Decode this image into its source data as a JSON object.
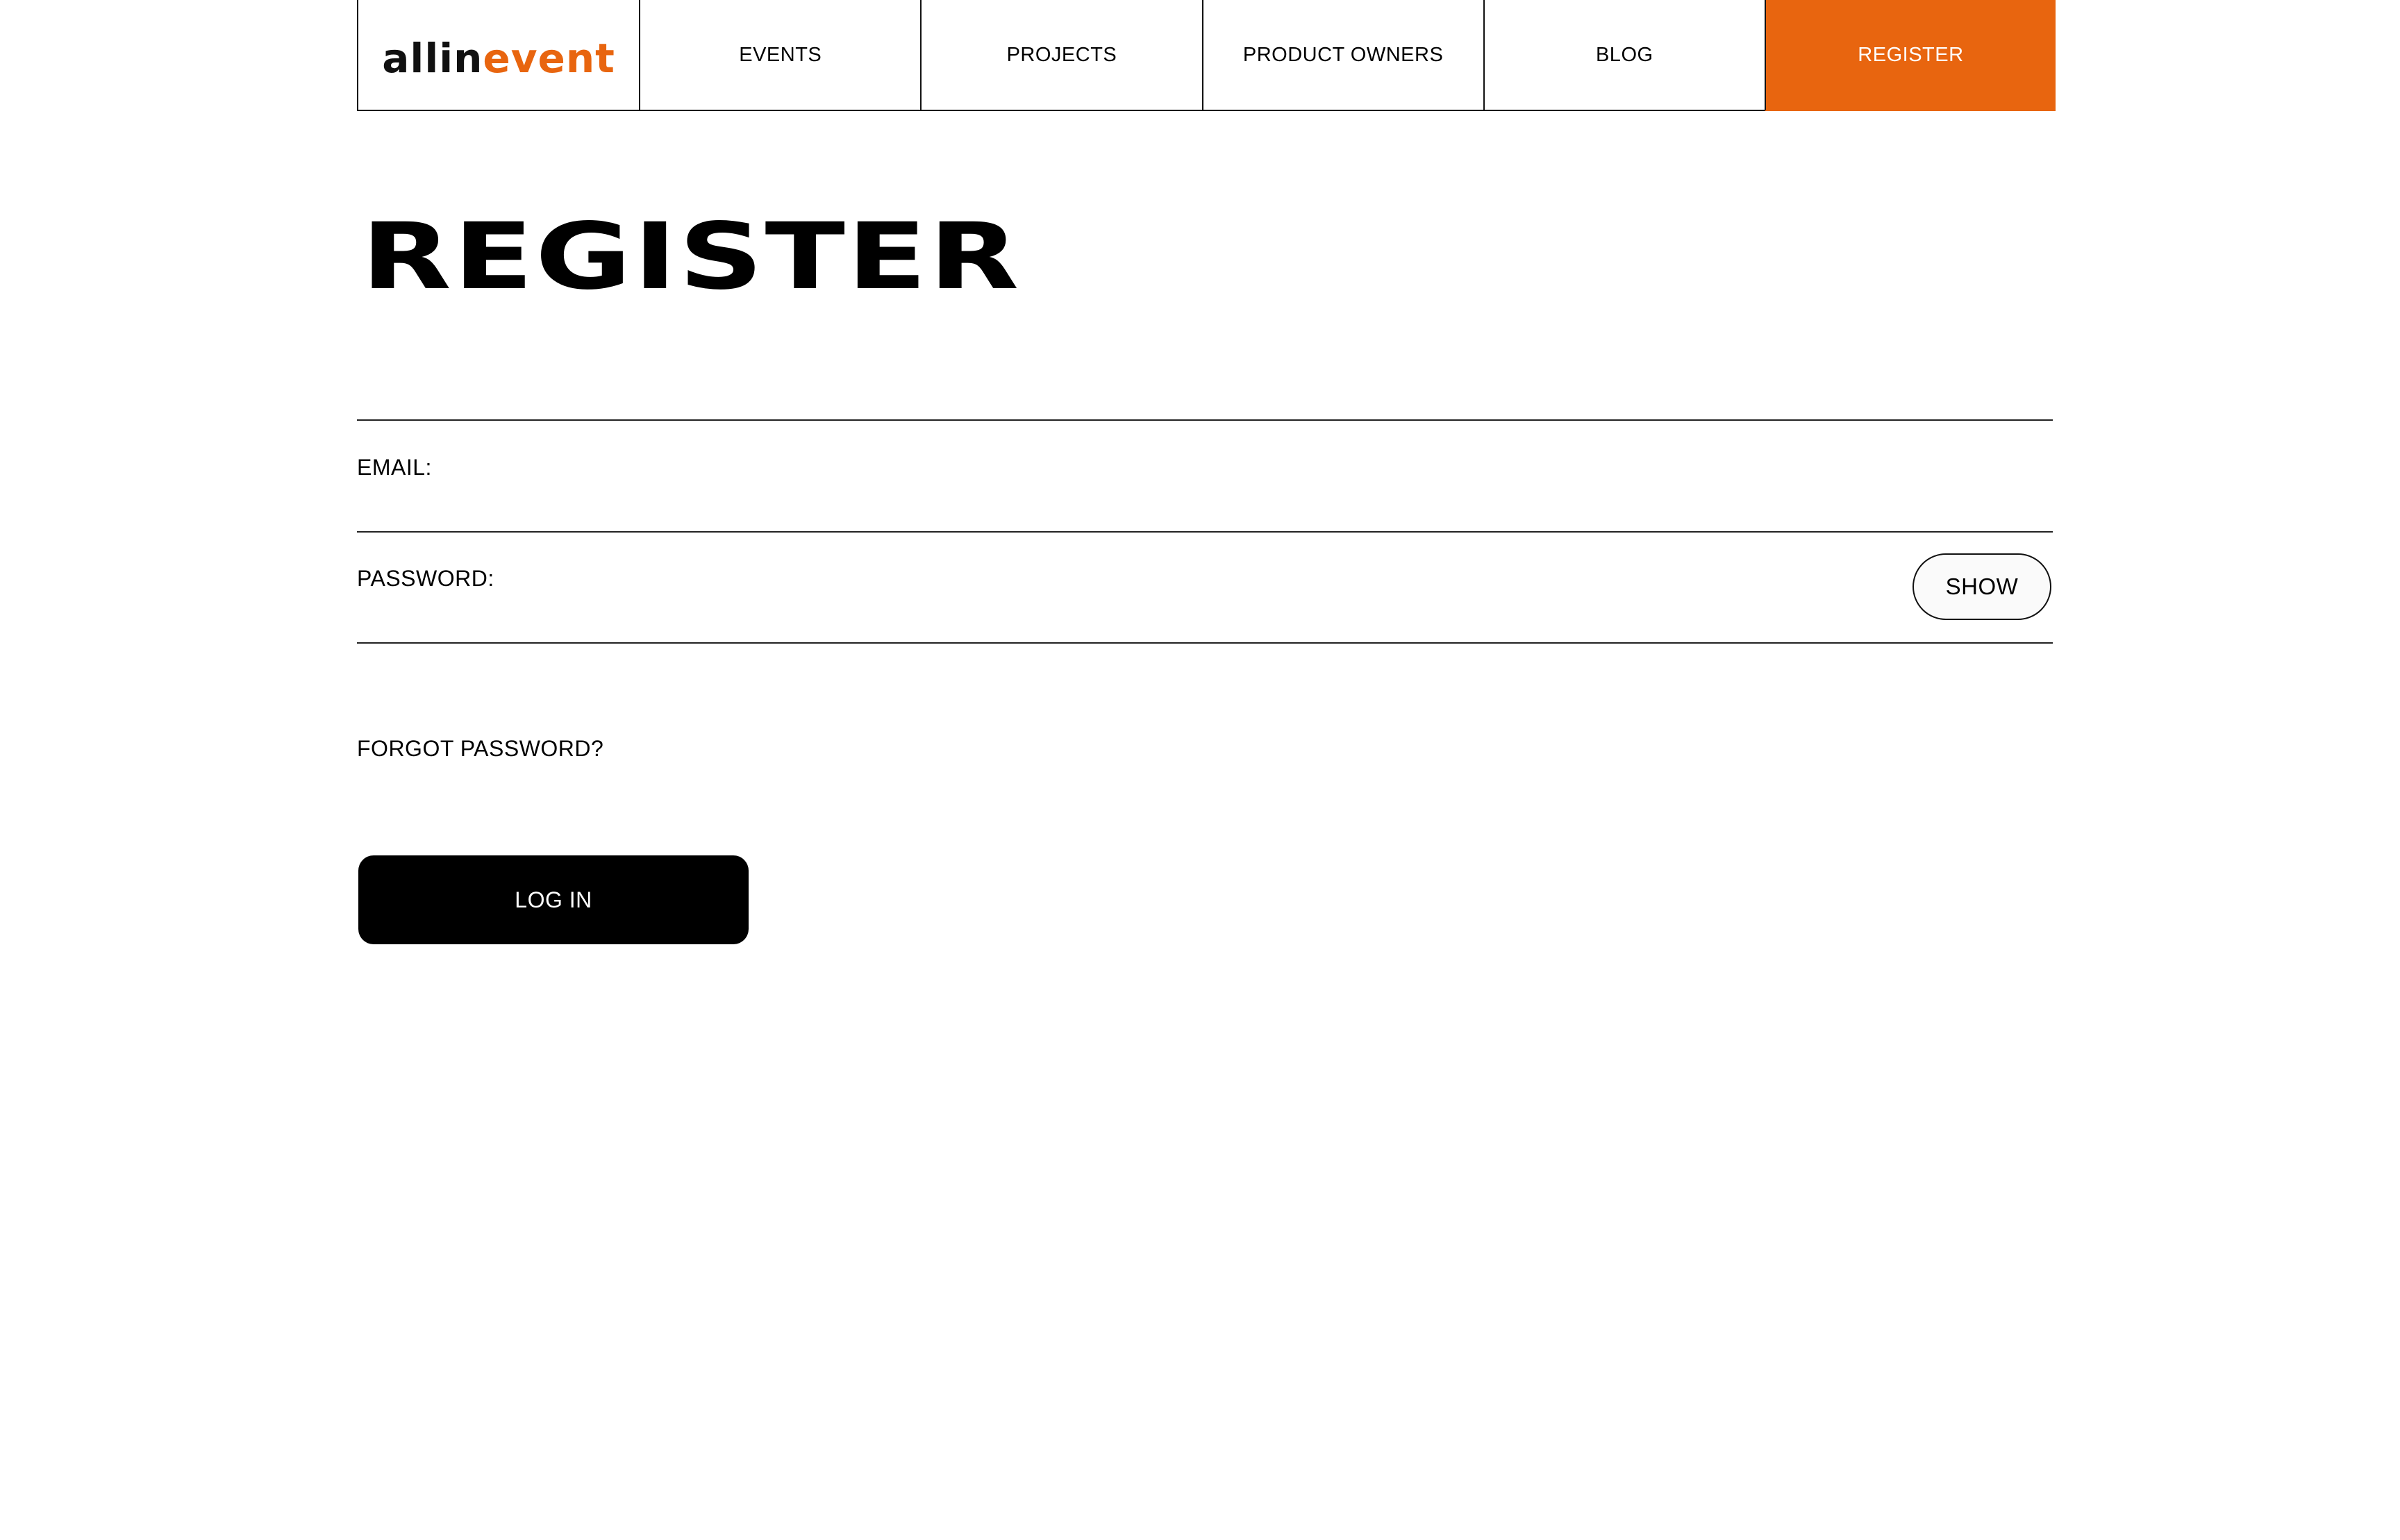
{
  "nav": {
    "logo_part1": "allin",
    "logo_part2": "event",
    "items": [
      {
        "label": "EVENTS"
      },
      {
        "label": "PROJECTS"
      },
      {
        "label": "PRODUCT OWNERS"
      },
      {
        "label": "BLOG"
      }
    ],
    "register_label": "REGISTER"
  },
  "page": {
    "title": "REGISTER"
  },
  "form": {
    "email_label": "EMAIL:",
    "email_value": "",
    "password_label": "PASSWORD:",
    "password_value": "",
    "show_label": "SHOW",
    "forgot_label": "FORGOT PASSWORD?",
    "login_label": "LOG IN"
  },
  "colors": {
    "accent": "#e8650f",
    "text": "#000000",
    "background": "#ffffff",
    "button_bg": "#000000"
  }
}
